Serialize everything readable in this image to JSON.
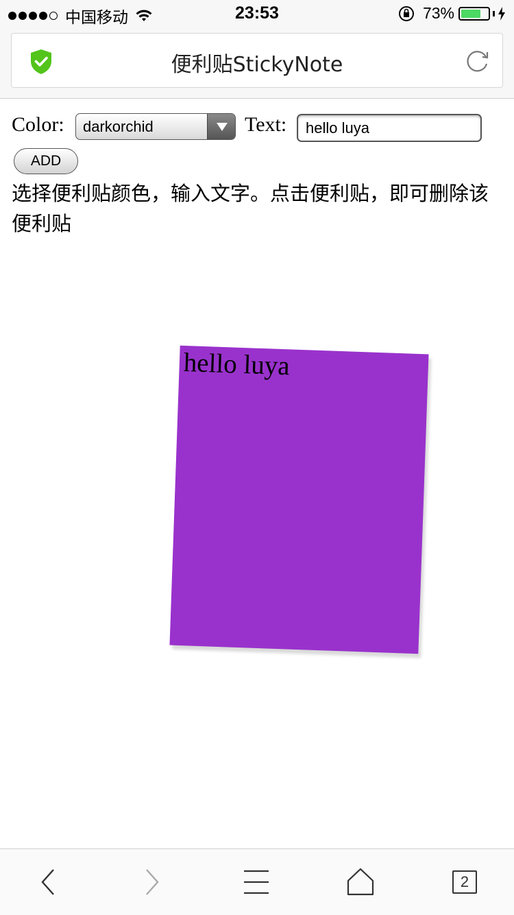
{
  "status_bar": {
    "carrier": "中国移动",
    "time": "23:53",
    "battery_percent": "73%",
    "battery_level": 0.73,
    "signal_bars_filled": 4,
    "signal_bars_total": 5
  },
  "browser": {
    "page_title": "便利贴StickyNote",
    "tab_count": "2",
    "accent_shield_color": "#52c41a"
  },
  "form": {
    "color_label": "Color:",
    "color_selected": "darkorchid",
    "text_label": "Text:",
    "text_value": "hello luya",
    "add_button_label": "ADD"
  },
  "instructions": "选择便利贴颜色，输入文字。点击便利贴，即可删除该便利贴",
  "notes": [
    {
      "text": "hello luya",
      "color": "#9932cc"
    }
  ],
  "toolbar": {
    "icons": [
      "back-icon",
      "forward-icon",
      "menu-icon",
      "home-icon",
      "tabs-icon"
    ]
  }
}
